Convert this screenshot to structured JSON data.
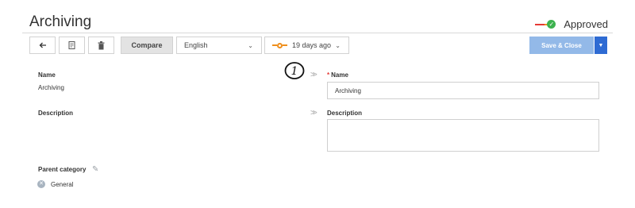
{
  "page": {
    "title": "Archiving"
  },
  "status": {
    "label": "Approved"
  },
  "toolbar": {
    "back_icon": "arrow-left-icon",
    "document_icon": "document-icon",
    "delete_icon": "trash-icon",
    "compare_label": "Compare",
    "language_value": "English",
    "version_value": "19 days ago",
    "save_label": "Save & Close"
  },
  "left": {
    "name_label": "Name",
    "name_value": "Archiving",
    "description_label": "Description",
    "parent_category_label": "Parent category",
    "parent_category_value": "General"
  },
  "right": {
    "name_label": "Name",
    "name_value": "Archiving",
    "description_label": "Description",
    "description_value": ""
  },
  "annotation": {
    "step_number": "1"
  },
  "colors": {
    "accent": "#2e6bd3",
    "save_disabled": "#93b9e8",
    "approved": "#3db24f",
    "required": "#e53935",
    "version": "#ef8f1d"
  }
}
